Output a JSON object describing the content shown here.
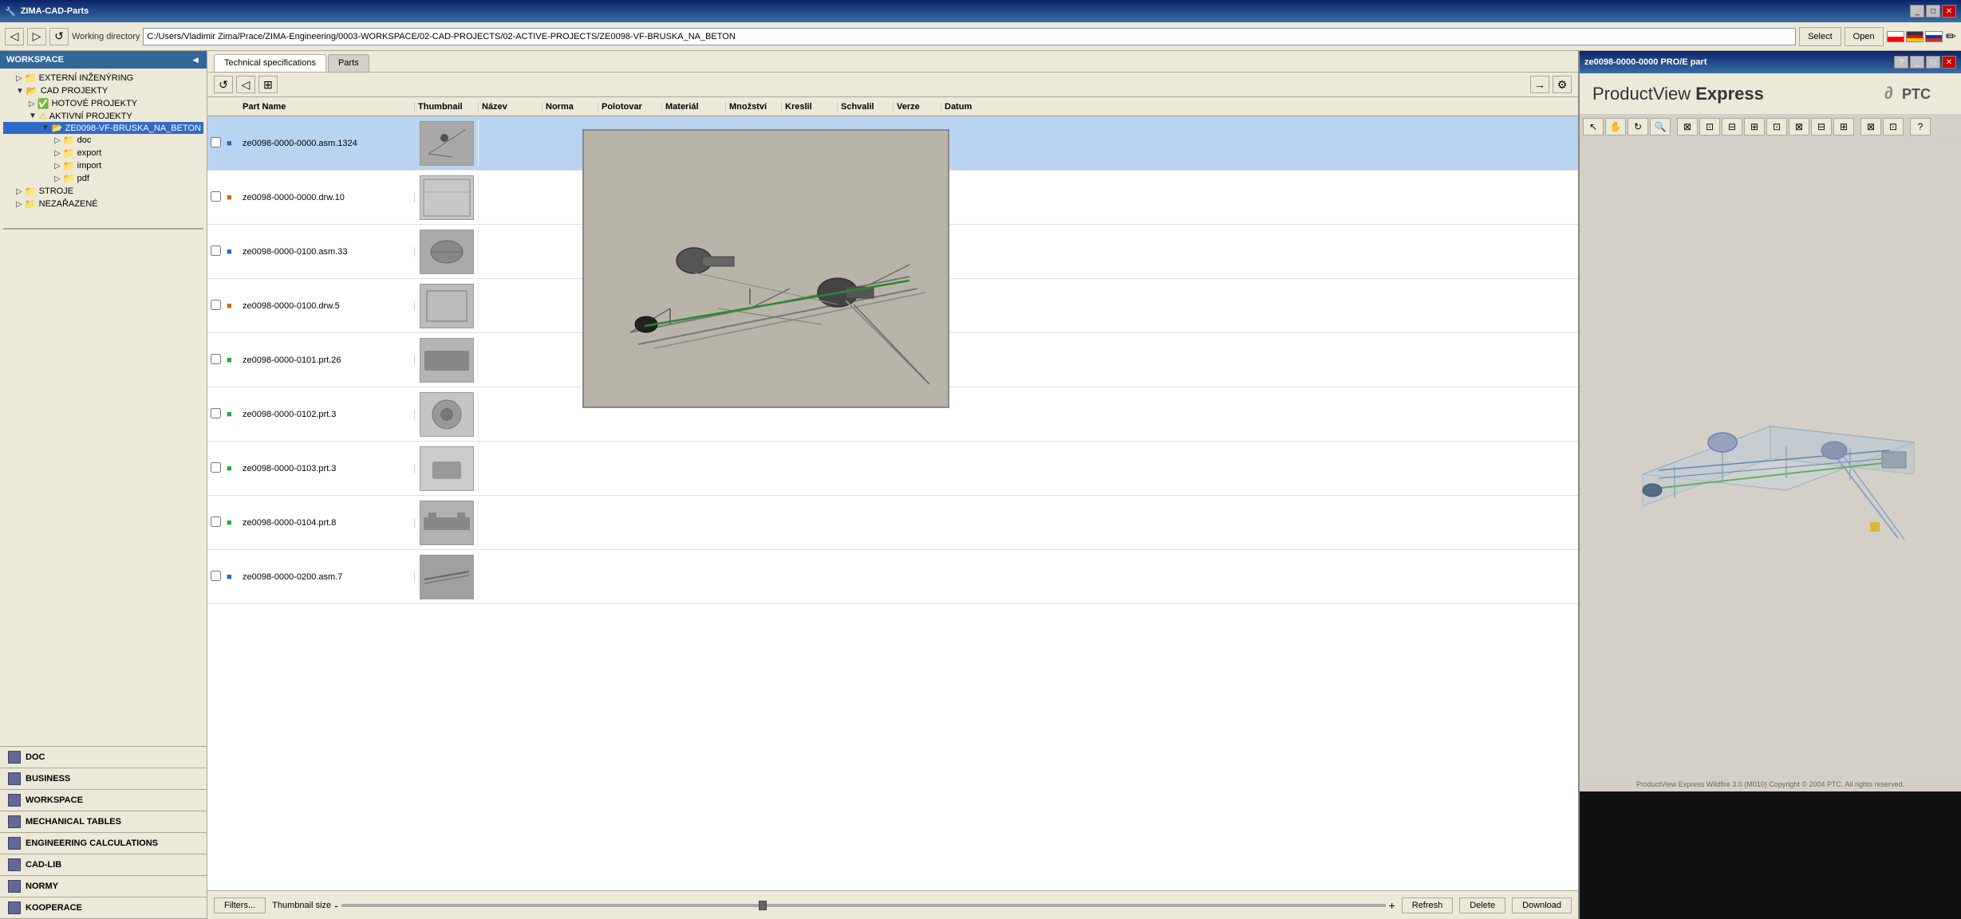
{
  "app": {
    "title": "ZIMA-CAD-Parts",
    "product_view_title": "ze0098-0000-0000 PRO/E part"
  },
  "toolbar": {
    "working_dir_label": "Working directory",
    "working_dir_path": "C:/Users/Vladimir Zima/Prace/ZIMA-Engineering/0003-WORKSPACE/02-CAD-PROJECTS/02-ACTIVE-PROJECTS/ZE0098-VF-BRUSKA_NA_BETON",
    "select_label": "Select",
    "open_label": "Open"
  },
  "sidebar": {
    "header": "WORKSPACE",
    "items": [
      {
        "label": "EXTERNÍ INŽENÝRING",
        "indent": 1,
        "icon": "folder",
        "expand": "▷"
      },
      {
        "label": "CAD PROJEKTY",
        "indent": 1,
        "icon": "folder",
        "expand": "▼"
      },
      {
        "label": "HOTOVÉ PROJEKTY",
        "indent": 2,
        "icon": "folder-check",
        "expand": "▷"
      },
      {
        "label": "AKTIVNÍ PROJEKTY",
        "indent": 2,
        "icon": "folder-warn",
        "expand": "▼"
      },
      {
        "label": "ZE0098-VF-BRUSKA_NA_BETON",
        "indent": 3,
        "icon": "folder-blue",
        "expand": "▼"
      },
      {
        "label": "doc",
        "indent": 4,
        "icon": "folder",
        "expand": "▷"
      },
      {
        "label": "export",
        "indent": 4,
        "icon": "folder",
        "expand": "▷"
      },
      {
        "label": "import",
        "indent": 4,
        "icon": "folder",
        "expand": "▷"
      },
      {
        "label": "pdf",
        "indent": 4,
        "icon": "folder",
        "expand": "▷"
      },
      {
        "label": "STROJE",
        "indent": 1,
        "icon": "folder",
        "expand": "▷"
      },
      {
        "label": "NEZAŘAZENÉ",
        "indent": 1,
        "icon": "folder",
        "expand": "▷"
      }
    ],
    "bottom_nav": [
      {
        "label": "DOC"
      },
      {
        "label": "BUSINESS"
      },
      {
        "label": "WORKSPACE"
      },
      {
        "label": "MECHANICAL TABLES"
      },
      {
        "label": "ENGINEERING CALCULATIONS"
      },
      {
        "label": "CAD-LIB"
      },
      {
        "label": "NORMY"
      },
      {
        "label": "KOOPERACE"
      }
    ]
  },
  "tabs": [
    {
      "label": "Technical specifications",
      "active": true
    },
    {
      "label": "Parts",
      "active": false
    }
  ],
  "table": {
    "columns": [
      "Part Name",
      "Thumbnail",
      "Název",
      "Norma",
      "Polotovar",
      "Materiál",
      "Množství",
      "Kreslil",
      "Schvalil",
      "Verze",
      "Datum"
    ],
    "rows": [
      {
        "name": "ze0098-0000-0000.asm.1324",
        "type": "asm",
        "thumbnail": "asm-thumb"
      },
      {
        "name": "ze0098-0000-0000.drw.10",
        "type": "drw",
        "thumbnail": "drw-thumb"
      },
      {
        "name": "ze0098-0000-0100.asm.33",
        "type": "asm",
        "thumbnail": "asm-sub-thumb"
      },
      {
        "name": "ze0098-0000-0100.drw.5",
        "type": "drw",
        "thumbnail": "drw-sub-thumb"
      },
      {
        "name": "ze0098-0000-0101.prt.26",
        "type": "prt",
        "thumbnail": "prt-thumb-1"
      },
      {
        "name": "ze0098-0000-0102.prt.3",
        "type": "prt",
        "thumbnail": "prt-thumb-2"
      },
      {
        "name": "ze0098-0000-0103.prt.3",
        "type": "prt",
        "thumbnail": "prt-thumb-3"
      },
      {
        "name": "ze0098-0000-0104.prt.8",
        "type": "prt",
        "thumbnail": "prt-thumb-4"
      },
      {
        "name": "ze0098-0000-0200.asm.7",
        "type": "asm",
        "thumbnail": "asm-sub2-thumb"
      }
    ]
  },
  "bottom_toolbar": {
    "filters_label": "Filters...",
    "thumbnail_size_label": "Thumbnail size",
    "refresh_label": "Refresh",
    "delete_label": "Delete",
    "download_label": "Download"
  },
  "product_view": {
    "logo_product": "ProductView ",
    "logo_express": "Express",
    "ptc_logo": "∂PTC",
    "footer_text": "ProductView Express Wildfire 3.0 (M010) Copyright © 2004 PTC.  All rights reserved.",
    "toolbar_icons": [
      "cursor",
      "pan",
      "rotate",
      "zoom-in",
      "zoom-out",
      "fit",
      "wireframe",
      "shaded",
      "hidden-line",
      "explode",
      "cross-section",
      "separator",
      "help"
    ]
  },
  "colors": {
    "title_bar_bg": "#0a246a",
    "sidebar_header_bg": "#336699",
    "tab_active_bg": "#ffffff",
    "tab_inactive_bg": "#d4d0c8",
    "selected_row_bg": "#b8d4f0",
    "toolbar_bg": "#ece9d8"
  }
}
